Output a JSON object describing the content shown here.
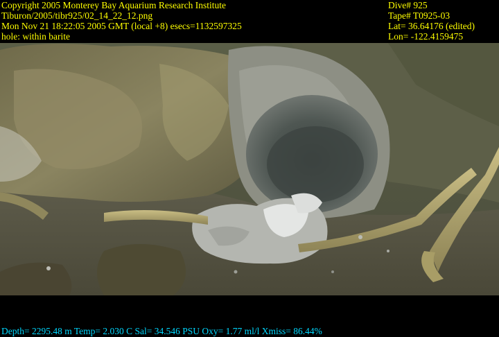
{
  "header": {
    "left_lines": [
      "Copyright 2005 Monterey Bay Aquarium Research Institute",
      "Tiburon/2005/tibr925/02_14_22_12.png",
      "Mon Nov 21 18:22:05 2005 GMT (local +8)  esecs=1132597325",
      "hole: within barite"
    ],
    "right_lines": [
      "Dive# 925",
      "Tape# T0925-03",
      "Lat= 36.64176 (edited)",
      "Lon= -122.4159475"
    ]
  },
  "footer": {
    "telemetry": "Depth= 2295.48 m  Temp= 2.030 C  Sal= 34.546 PSU  Oxy= 1.77 ml/l  Xmiss= 86.44%"
  },
  "colors": {
    "header_text": "#ffff00",
    "footer_text": "#00d8ff",
    "background": "#000000"
  }
}
